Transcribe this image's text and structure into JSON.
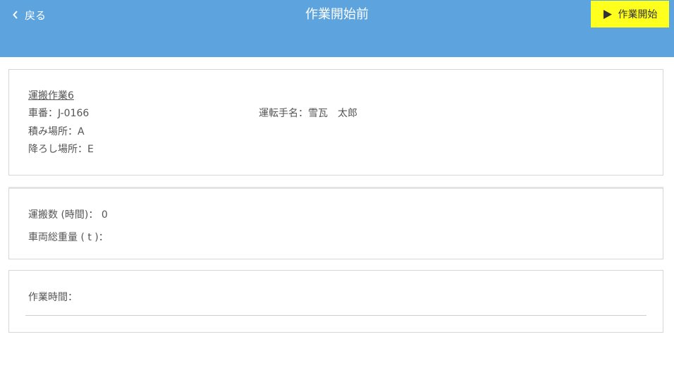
{
  "header": {
    "back_label": "戻る",
    "title": "作業開始前",
    "start_label": "作業開始",
    "bg_color": "#5da3de",
    "start_color": "#ffff1e"
  },
  "job": {
    "title": "運搬作業6",
    "vehicle_label": "車番：",
    "vehicle_value": "J-0166",
    "driver_label": "運転手名：",
    "driver_value": "雪瓦　太郎",
    "load_label": "積み場所：",
    "load_value": "A",
    "unload_label": "降ろし場所：",
    "unload_value": "E"
  },
  "stats": {
    "trips_label": "運搬数 (時間)：",
    "trips_value": "0",
    "weight_label": "車両総重量 ( t )：",
    "weight_value": ""
  },
  "work": {
    "time_label": "作業時間：",
    "time_value": ""
  },
  "icons": {
    "back": "chevron-left-icon",
    "start": "play-icon"
  }
}
